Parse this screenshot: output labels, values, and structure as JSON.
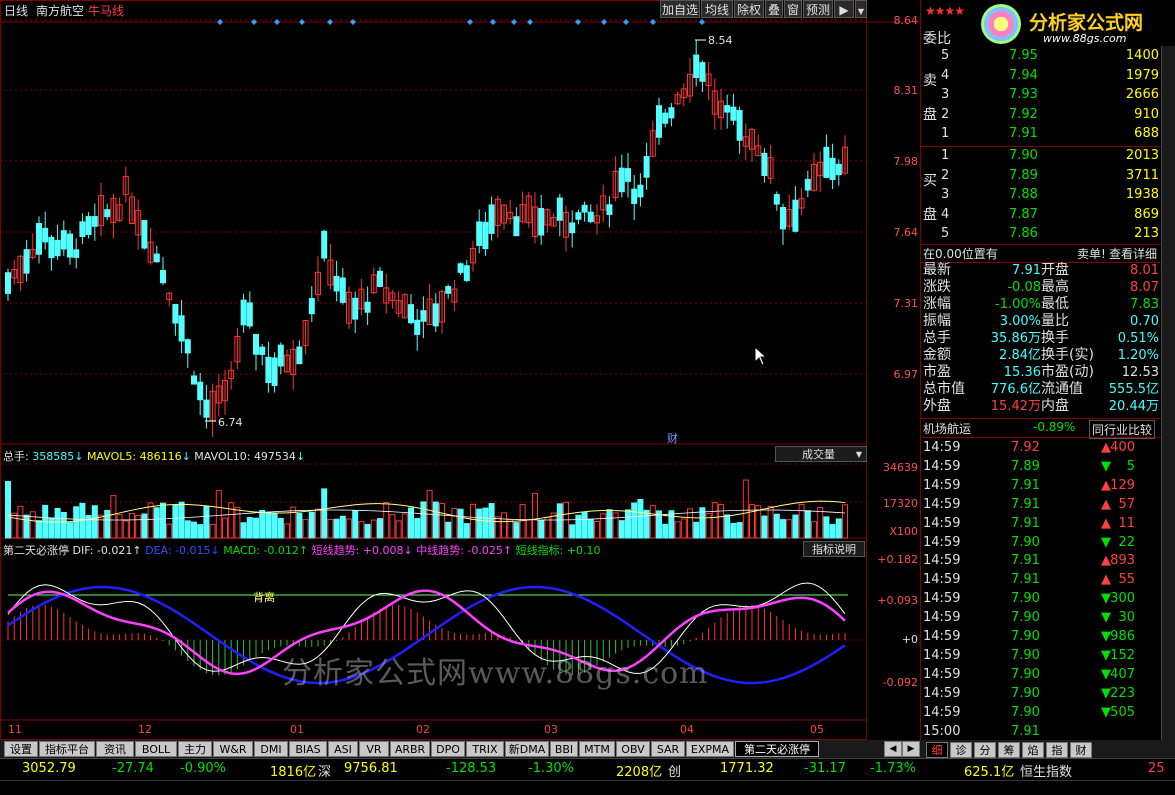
{
  "header": {
    "period": "日线",
    "stock_name": "南方航空",
    "indicator": "牛马线",
    "buttons": [
      "加自选",
      "均线",
      "除权",
      "叠",
      "窗",
      "预测"
    ],
    "nav_icon": "triangle-right-icon",
    "dropdown_icon": "triangle-down-icon"
  },
  "price_axis": [
    "8.64",
    "8.31",
    "7.98",
    "7.64",
    "7.31",
    "6.97"
  ],
  "annotations": {
    "high_label": "8.54",
    "low_label": "6.74",
    "fin_marker": "财"
  },
  "volume_panel": {
    "line": "总手: 358585↓ MAVOL5: 486116↓ MAVOL10: 497534↓",
    "total_label": "总手:",
    "total_value": "358585",
    "mavol5_label": "MAVOL5:",
    "mavol5_value": "486116",
    "mavol10_label": "MAVOL10:",
    "mavol10_value": "497534",
    "arrow": "↓",
    "selector": "成交量",
    "axis": [
      "34639",
      "17320"
    ],
    "unit": "X100"
  },
  "macd_panel": {
    "title": "第二天必涨停",
    "dif": "DIF: -0.021↑",
    "dea": "DEA: -0.015↓",
    "macd": "MACD: -0.012↑",
    "short": "短线趋势: +0.008↓",
    "mid": "中线趋势: -0.025↑",
    "ind": "短线指标: +0.10",
    "help": "指标说明",
    "axis": [
      "+0.182",
      "+0.093",
      "+0",
      "-0.092"
    ],
    "divergence": "背离"
  },
  "watermark": "分析家公式网www.88gs.com",
  "x_axis": [
    "11",
    "12",
    "01",
    "02",
    "03",
    "04",
    "05"
  ],
  "right_panel": {
    "logo_text": "分析家公式网",
    "logo_url": "www.88gs.com",
    "weibi": "委比",
    "sell_label": [
      "卖",
      "盘"
    ],
    "buy_label": [
      "买",
      "盘"
    ],
    "sells": [
      {
        "n": "5",
        "p": "7.95",
        "v": "1400"
      },
      {
        "n": "4",
        "p": "7.94",
        "v": "1979"
      },
      {
        "n": "3",
        "p": "7.93",
        "v": "2666"
      },
      {
        "n": "2",
        "p": "7.92",
        "v": "910"
      },
      {
        "n": "1",
        "p": "7.91",
        "v": "688"
      }
    ],
    "buys": [
      {
        "n": "1",
        "p": "7.90",
        "v": "2013"
      },
      {
        "n": "2",
        "p": "7.89",
        "v": "3711"
      },
      {
        "n": "3",
        "p": "7.88",
        "v": "1938"
      },
      {
        "n": "4",
        "p": "7.87",
        "v": "869"
      },
      {
        "n": "5",
        "p": "7.86",
        "v": "213"
      }
    ],
    "position_line": "在0.00位置有",
    "sell_detail": "卖单!",
    "view_detail": "查看详细",
    "stats": [
      {
        "l1": "最新",
        "v1": "7.91",
        "l2": "开盘",
        "v2": "8.01"
      },
      {
        "l1": "涨跌",
        "v1": "-0.08",
        "l2": "最高",
        "v2": "8.07"
      },
      {
        "l1": "涨幅",
        "v1": "-1.00%",
        "l2": "最低",
        "v2": "7.83"
      },
      {
        "l1": "振幅",
        "v1": "3.00%",
        "l2": "量比",
        "v2": "0.70"
      },
      {
        "l1": "总手",
        "v1": "35.86万",
        "l2": "换手",
        "v2": "0.51%"
      },
      {
        "l1": "金额",
        "v1": "2.84亿",
        "l2": "换手(实)",
        "v2": "1.20%"
      },
      {
        "l1": "市盈",
        "v1": "15.36",
        "l2": "市盈(动)",
        "v2": "12.53"
      },
      {
        "l1": "总市值",
        "v1": "776.6亿",
        "l2": "流通值",
        "v2": "555.5亿"
      },
      {
        "l1": "外盘",
        "v1": "15.42万",
        "l2": "内盘",
        "v2": "20.44万"
      }
    ],
    "sector": "机场航运",
    "sector_change": "-0.89%",
    "compare": "同行业比较",
    "ticks": [
      {
        "t": "14:59",
        "p": "7.92",
        "v": "400",
        "d": "up"
      },
      {
        "t": "14:59",
        "p": "7.89",
        "v": "5",
        "d": "down"
      },
      {
        "t": "14:59",
        "p": "7.91",
        "v": "129",
        "d": "up"
      },
      {
        "t": "14:59",
        "p": "7.91",
        "v": "57",
        "d": "up"
      },
      {
        "t": "14:59",
        "p": "7.91",
        "v": "11",
        "d": "up"
      },
      {
        "t": "14:59",
        "p": "7.90",
        "v": "22",
        "d": "down"
      },
      {
        "t": "14:59",
        "p": "7.91",
        "v": "893",
        "d": "up"
      },
      {
        "t": "14:59",
        "p": "7.91",
        "v": "55",
        "d": "up"
      },
      {
        "t": "14:59",
        "p": "7.90",
        "v": "300",
        "d": "down"
      },
      {
        "t": "14:59",
        "p": "7.90",
        "v": "30",
        "d": "down"
      },
      {
        "t": "14:59",
        "p": "7.90",
        "v": "986",
        "d": "down"
      },
      {
        "t": "14:59",
        "p": "7.90",
        "v": "152",
        "d": "down"
      },
      {
        "t": "14:59",
        "p": "7.90",
        "v": "407",
        "d": "down"
      },
      {
        "t": "14:59",
        "p": "7.90",
        "v": "223",
        "d": "down"
      },
      {
        "t": "14:59",
        "p": "7.90",
        "v": "505",
        "d": "down"
      },
      {
        "t": "15:00",
        "p": "7.91",
        "v": "",
        "d": ""
      }
    ],
    "tick_edge": "1",
    "bottom_tabs": [
      "细",
      "诊",
      "分",
      "筹",
      "焰",
      "指",
      "财"
    ]
  },
  "bottom_tabs": [
    "设置",
    "指标平台",
    "资讯",
    "BOLL",
    "主力",
    "W&R",
    "DMI",
    "BIAS",
    "ASI",
    "VR",
    "ARBR",
    "DPO",
    "TRIX",
    "新DMA",
    "BBI",
    "MTM",
    "OBV",
    "SAR",
    "EXPMA",
    "第二天必涨停"
  ],
  "ticker": {
    "sh_index": "3052.79",
    "sh_chg": "-27.74",
    "sh_pct": "-0.90%",
    "sh_amt": "1816亿",
    "sz_label": "深",
    "sz_index": "9756.81",
    "sz_chg": "-128.53",
    "sz_pct": "-1.30%",
    "sz_amt": "2208亿",
    "cy_label": "创",
    "cy_index": "1771.32",
    "cy_chg": "-31.17",
    "cy_pct": "-1.73%",
    "cy_amt": "625.1亿",
    "hs_label": "恒生指数",
    "hs_tail": "25"
  },
  "colors": {
    "up": "#ff3333",
    "down": "#54ffff",
    "grid": "#800000",
    "dif": "#ffffff",
    "dea": "#2020ff",
    "short": "#ff40ff",
    "divline": "#60ff60"
  }
}
